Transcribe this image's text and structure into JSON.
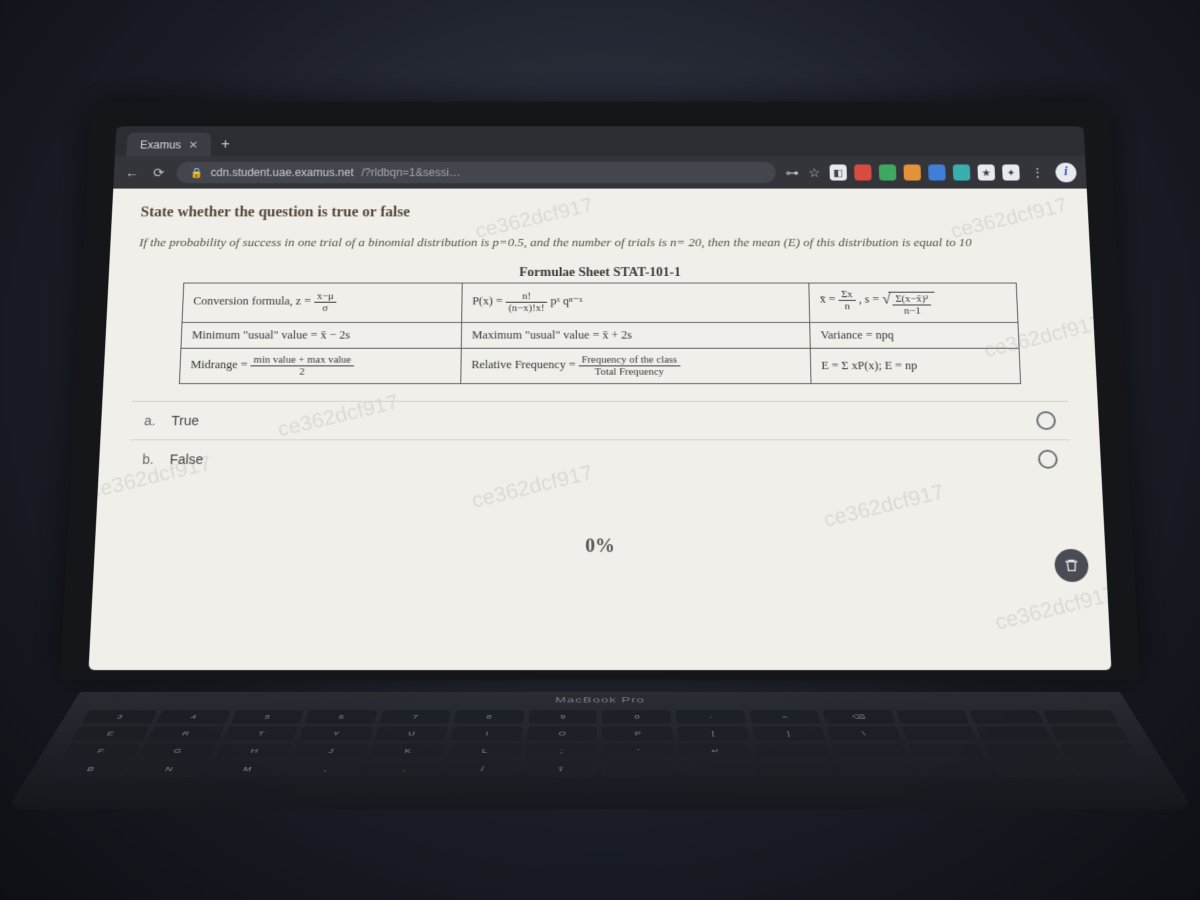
{
  "browser": {
    "tab_title": "Examus",
    "url_host": "cdn.student.uae.examus.net",
    "url_path": "/?rldbqn=1&sessi…"
  },
  "toolbar": {
    "back": "←",
    "reload": "⟳",
    "lock": "🔒",
    "star": "☆",
    "key": "⊶",
    "menu": "⋮"
  },
  "page": {
    "instruction": "State whether the question is true or false",
    "question": "If the probability of success in one trial of a binomial distribution is p=0.5, and the number of trials is n= 20, then the mean (E) of this distribution is equal to 10",
    "formula_sheet_title": "Formulae Sheet  STAT-101-1",
    "formula": {
      "r1c1": "Conversion formula, z =",
      "r1c1_frac_num": "x−μ",
      "r1c1_frac_den": "σ",
      "r1c2_lead": "P(x) =",
      "r1c2_frac_num": "n!",
      "r1c2_frac_den": "(n−x)!x!",
      "r1c2_tail": " pˣ qⁿ⁻ˣ",
      "r1c3_a": "x̄ =",
      "r1c3_a_num": "Σx",
      "r1c3_a_den": "n",
      "r1c3_b": " ,  s =",
      "r1c3_b_rad_num": "Σ(x−x̄)²",
      "r1c3_b_rad_den": "n−1",
      "r2c1": "Minimum \"usual\" value = x̄ − 2s",
      "r2c2": "Maximum \"usual\" value = x̄ + 2s",
      "r2c3": "Variance = npq",
      "r3c1_lead": "Midrange =",
      "r3c1_num": "min value + max value",
      "r3c1_den": "2",
      "r3c2_lead": "Relative Frequency =",
      "r3c2_num": "Frequency of the class",
      "r3c2_den": "Total Frequency",
      "r3c3": "E = Σ xP(x);     E = np"
    },
    "options": {
      "a_key": "a.",
      "a_text": "True",
      "b_key": "b.",
      "b_text": "False"
    },
    "progress": "0%",
    "watermark": "ce362dcf917"
  },
  "laptop_model": "MacBook Pro",
  "keys": [
    "3",
    "4",
    "5",
    "6",
    "7",
    "8",
    "9",
    "0",
    "-",
    "=",
    "⌫",
    "",
    "",
    "",
    "E",
    "R",
    "T",
    "Y",
    "U",
    "I",
    "O",
    "P",
    "[",
    "]",
    "\\",
    "",
    "",
    "",
    "F",
    "G",
    "H",
    "J",
    "K",
    "L",
    ";",
    "'",
    "↵",
    "",
    "",
    "",
    "",
    "",
    "B",
    "N",
    "M",
    ",",
    ".",
    "/",
    "⇧",
    "",
    "",
    "",
    "",
    "",
    "",
    ""
  ]
}
